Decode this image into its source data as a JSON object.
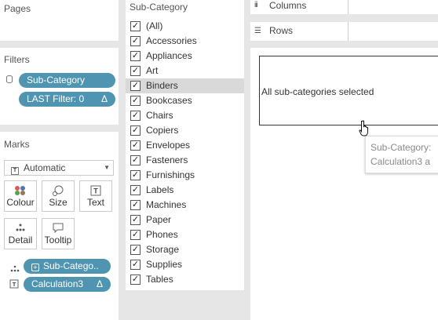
{
  "cards": {
    "pages": {
      "title": "Pages"
    },
    "filters": {
      "title": "Filters",
      "pills": [
        {
          "label": "Sub-Category"
        },
        {
          "label": "LAST Filter: 0",
          "badge": "Δ"
        }
      ]
    },
    "marks": {
      "title": "Marks",
      "mark_type": "Automatic",
      "buttons": [
        {
          "label": "Colour",
          "icon": "colour-icon"
        },
        {
          "label": "Size",
          "icon": "size-icon"
        },
        {
          "label": "Text",
          "icon": "text-icon"
        },
        {
          "label": "Detail",
          "icon": "detail-icon"
        },
        {
          "label": "Tooltip",
          "icon": "tooltip-icon"
        }
      ],
      "fields": [
        {
          "label": "Sub-Catego..",
          "icon": "detail-icon"
        },
        {
          "label": "Calculation3",
          "badge": "Δ",
          "icon": "text-icon"
        }
      ]
    }
  },
  "subcategory_filter": {
    "title": "Sub-Category",
    "highlighted": "Binders",
    "items": [
      {
        "label": "(All)",
        "checked": true
      },
      {
        "label": "Accessories",
        "checked": true
      },
      {
        "label": "Appliances",
        "checked": true
      },
      {
        "label": "Art",
        "checked": true
      },
      {
        "label": "Binders",
        "checked": true
      },
      {
        "label": "Bookcases",
        "checked": true
      },
      {
        "label": "Chairs",
        "checked": true
      },
      {
        "label": "Copiers",
        "checked": true
      },
      {
        "label": "Envelopes",
        "checked": true
      },
      {
        "label": "Fasteners",
        "checked": true
      },
      {
        "label": "Furnishings",
        "checked": true
      },
      {
        "label": "Labels",
        "checked": true
      },
      {
        "label": "Machines",
        "checked": true
      },
      {
        "label": "Paper",
        "checked": true
      },
      {
        "label": "Phones",
        "checked": true
      },
      {
        "label": "Storage",
        "checked": true
      },
      {
        "label": "Supplies",
        "checked": true
      },
      {
        "label": "Tables",
        "checked": true
      }
    ]
  },
  "shelves": {
    "columns": "Columns",
    "rows": "Rows"
  },
  "view": {
    "message": "All sub-categories selected"
  },
  "tooltip": {
    "line1": "Sub-Category:",
    "line2": "Calculation3 a"
  },
  "colors": {
    "pill": "#4f94b0",
    "highlight": "#d9d9d9"
  }
}
